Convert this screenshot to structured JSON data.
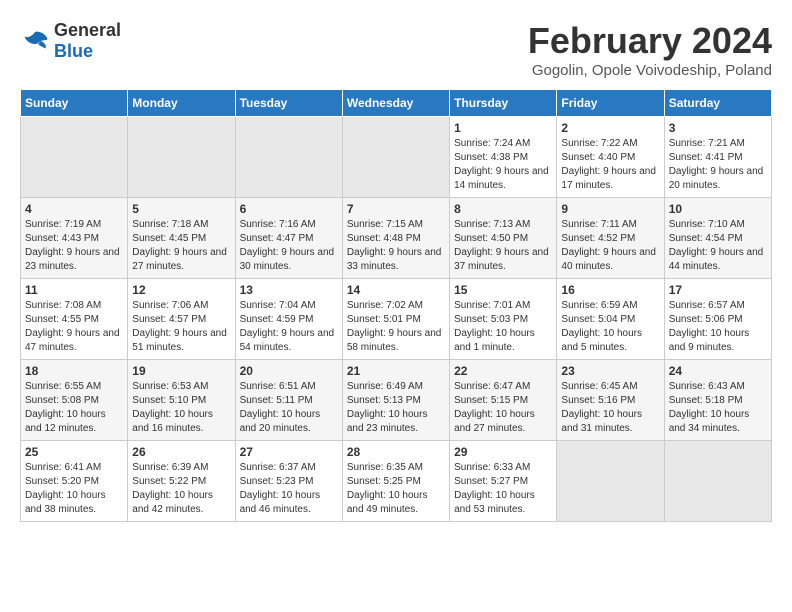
{
  "header": {
    "logo": {
      "general": "General",
      "blue": "Blue"
    },
    "title": "February 2024",
    "location": "Gogolin, Opole Voivodeship, Poland"
  },
  "calendar": {
    "days_of_week": [
      "Sunday",
      "Monday",
      "Tuesday",
      "Wednesday",
      "Thursday",
      "Friday",
      "Saturday"
    ],
    "weeks": [
      [
        {
          "day": "",
          "info": ""
        },
        {
          "day": "",
          "info": ""
        },
        {
          "day": "",
          "info": ""
        },
        {
          "day": "",
          "info": ""
        },
        {
          "day": "1",
          "info": "Sunrise: 7:24 AM\nSunset: 4:38 PM\nDaylight: 9 hours\nand 14 minutes."
        },
        {
          "day": "2",
          "info": "Sunrise: 7:22 AM\nSunset: 4:40 PM\nDaylight: 9 hours\nand 17 minutes."
        },
        {
          "day": "3",
          "info": "Sunrise: 7:21 AM\nSunset: 4:41 PM\nDaylight: 9 hours\nand 20 minutes."
        }
      ],
      [
        {
          "day": "4",
          "info": "Sunrise: 7:19 AM\nSunset: 4:43 PM\nDaylight: 9 hours\nand 23 minutes."
        },
        {
          "day": "5",
          "info": "Sunrise: 7:18 AM\nSunset: 4:45 PM\nDaylight: 9 hours\nand 27 minutes."
        },
        {
          "day": "6",
          "info": "Sunrise: 7:16 AM\nSunset: 4:47 PM\nDaylight: 9 hours\nand 30 minutes."
        },
        {
          "day": "7",
          "info": "Sunrise: 7:15 AM\nSunset: 4:48 PM\nDaylight: 9 hours\nand 33 minutes."
        },
        {
          "day": "8",
          "info": "Sunrise: 7:13 AM\nSunset: 4:50 PM\nDaylight: 9 hours\nand 37 minutes."
        },
        {
          "day": "9",
          "info": "Sunrise: 7:11 AM\nSunset: 4:52 PM\nDaylight: 9 hours\nand 40 minutes."
        },
        {
          "day": "10",
          "info": "Sunrise: 7:10 AM\nSunset: 4:54 PM\nDaylight: 9 hours\nand 44 minutes."
        }
      ],
      [
        {
          "day": "11",
          "info": "Sunrise: 7:08 AM\nSunset: 4:55 PM\nDaylight: 9 hours\nand 47 minutes."
        },
        {
          "day": "12",
          "info": "Sunrise: 7:06 AM\nSunset: 4:57 PM\nDaylight: 9 hours\nand 51 minutes."
        },
        {
          "day": "13",
          "info": "Sunrise: 7:04 AM\nSunset: 4:59 PM\nDaylight: 9 hours\nand 54 minutes."
        },
        {
          "day": "14",
          "info": "Sunrise: 7:02 AM\nSunset: 5:01 PM\nDaylight: 9 hours\nand 58 minutes."
        },
        {
          "day": "15",
          "info": "Sunrise: 7:01 AM\nSunset: 5:03 PM\nDaylight: 10 hours\nand 1 minute."
        },
        {
          "day": "16",
          "info": "Sunrise: 6:59 AM\nSunset: 5:04 PM\nDaylight: 10 hours\nand 5 minutes."
        },
        {
          "day": "17",
          "info": "Sunrise: 6:57 AM\nSunset: 5:06 PM\nDaylight: 10 hours\nand 9 minutes."
        }
      ],
      [
        {
          "day": "18",
          "info": "Sunrise: 6:55 AM\nSunset: 5:08 PM\nDaylight: 10 hours\nand 12 minutes."
        },
        {
          "day": "19",
          "info": "Sunrise: 6:53 AM\nSunset: 5:10 PM\nDaylight: 10 hours\nand 16 minutes."
        },
        {
          "day": "20",
          "info": "Sunrise: 6:51 AM\nSunset: 5:11 PM\nDaylight: 10 hours\nand 20 minutes."
        },
        {
          "day": "21",
          "info": "Sunrise: 6:49 AM\nSunset: 5:13 PM\nDaylight: 10 hours\nand 23 minutes."
        },
        {
          "day": "22",
          "info": "Sunrise: 6:47 AM\nSunset: 5:15 PM\nDaylight: 10 hours\nand 27 minutes."
        },
        {
          "day": "23",
          "info": "Sunrise: 6:45 AM\nSunset: 5:16 PM\nDaylight: 10 hours\nand 31 minutes."
        },
        {
          "day": "24",
          "info": "Sunrise: 6:43 AM\nSunset: 5:18 PM\nDaylight: 10 hours\nand 34 minutes."
        }
      ],
      [
        {
          "day": "25",
          "info": "Sunrise: 6:41 AM\nSunset: 5:20 PM\nDaylight: 10 hours\nand 38 minutes."
        },
        {
          "day": "26",
          "info": "Sunrise: 6:39 AM\nSunset: 5:22 PM\nDaylight: 10 hours\nand 42 minutes."
        },
        {
          "day": "27",
          "info": "Sunrise: 6:37 AM\nSunset: 5:23 PM\nDaylight: 10 hours\nand 46 minutes."
        },
        {
          "day": "28",
          "info": "Sunrise: 6:35 AM\nSunset: 5:25 PM\nDaylight: 10 hours\nand 49 minutes."
        },
        {
          "day": "29",
          "info": "Sunrise: 6:33 AM\nSunset: 5:27 PM\nDaylight: 10 hours\nand 53 minutes."
        },
        {
          "day": "",
          "info": ""
        },
        {
          "day": "",
          "info": ""
        }
      ]
    ]
  }
}
